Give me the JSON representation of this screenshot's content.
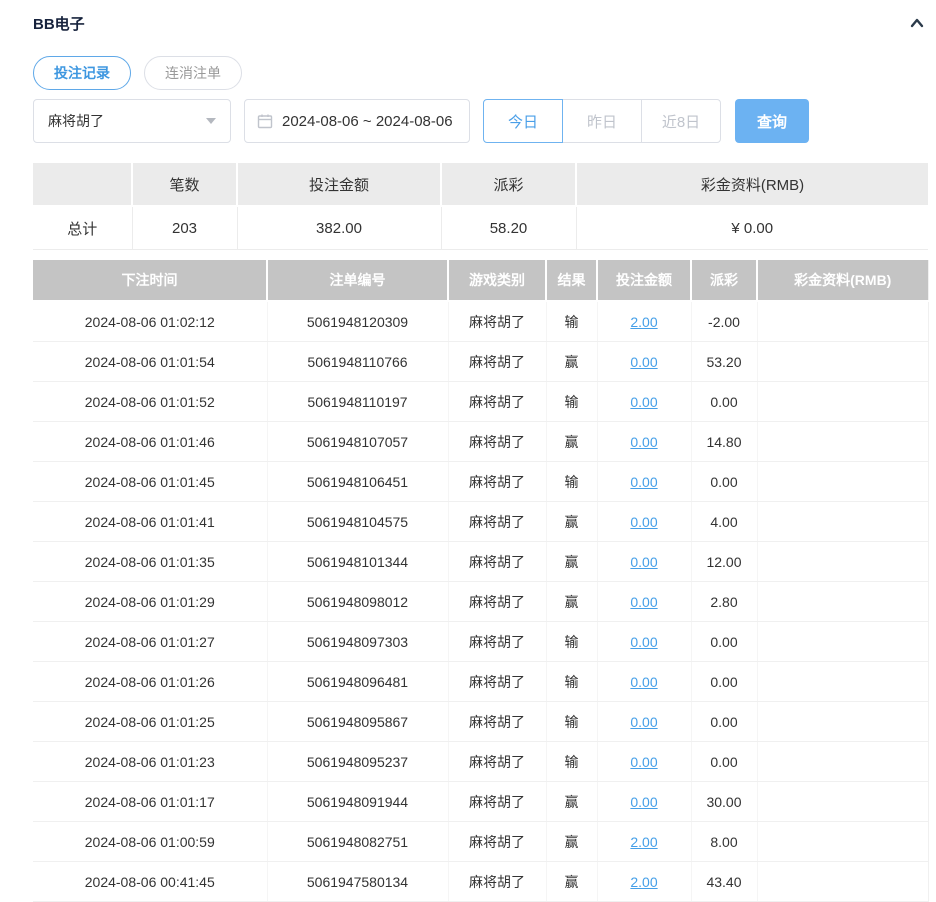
{
  "header": {
    "title": "BB电子"
  },
  "tabs": [
    {
      "label": "投注记录",
      "active": true
    },
    {
      "label": "连消注单",
      "active": false
    }
  ],
  "filters": {
    "game_select": {
      "value": "麻将胡了"
    },
    "date_range": "2024-08-06 ~ 2024-08-06",
    "quick_buttons": [
      {
        "label": "今日",
        "active": true
      },
      {
        "label": "昨日",
        "active": false
      },
      {
        "label": "近8日",
        "active": false
      }
    ],
    "search_label": "查询"
  },
  "summary": {
    "headers": [
      "",
      "笔数",
      "投注金额",
      "派彩",
      "彩金资料(RMB)"
    ],
    "row": {
      "label": "总计",
      "count": "203",
      "bet": "382.00",
      "payout": "58.20",
      "bonus": "¥ 0.00"
    }
  },
  "table": {
    "headers": [
      "下注时间",
      "注单编号",
      "游戏类别",
      "结果",
      "投注金额",
      "派彩",
      "彩金资料(RMB)"
    ],
    "rows": [
      {
        "time": "2024-08-06 01:02:12",
        "order": "5061948120309",
        "game": "麻将胡了",
        "result": "输",
        "bet": "2.00",
        "payout": "-2.00",
        "bonus": ""
      },
      {
        "time": "2024-08-06 01:01:54",
        "order": "5061948110766",
        "game": "麻将胡了",
        "result": "赢",
        "bet": "0.00",
        "payout": "53.20",
        "bonus": ""
      },
      {
        "time": "2024-08-06 01:01:52",
        "order": "5061948110197",
        "game": "麻将胡了",
        "result": "输",
        "bet": "0.00",
        "payout": "0.00",
        "bonus": ""
      },
      {
        "time": "2024-08-06 01:01:46",
        "order": "5061948107057",
        "game": "麻将胡了",
        "result": "赢",
        "bet": "0.00",
        "payout": "14.80",
        "bonus": ""
      },
      {
        "time": "2024-08-06 01:01:45",
        "order": "5061948106451",
        "game": "麻将胡了",
        "result": "输",
        "bet": "0.00",
        "payout": "0.00",
        "bonus": ""
      },
      {
        "time": "2024-08-06 01:01:41",
        "order": "5061948104575",
        "game": "麻将胡了",
        "result": "赢",
        "bet": "0.00",
        "payout": "4.00",
        "bonus": ""
      },
      {
        "time": "2024-08-06 01:01:35",
        "order": "5061948101344",
        "game": "麻将胡了",
        "result": "赢",
        "bet": "0.00",
        "payout": "12.00",
        "bonus": ""
      },
      {
        "time": "2024-08-06 01:01:29",
        "order": "5061948098012",
        "game": "麻将胡了",
        "result": "赢",
        "bet": "0.00",
        "payout": "2.80",
        "bonus": ""
      },
      {
        "time": "2024-08-06 01:01:27",
        "order": "5061948097303",
        "game": "麻将胡了",
        "result": "输",
        "bet": "0.00",
        "payout": "0.00",
        "bonus": ""
      },
      {
        "time": "2024-08-06 01:01:26",
        "order": "5061948096481",
        "game": "麻将胡了",
        "result": "输",
        "bet": "0.00",
        "payout": "0.00",
        "bonus": ""
      },
      {
        "time": "2024-08-06 01:01:25",
        "order": "5061948095867",
        "game": "麻将胡了",
        "result": "输",
        "bet": "0.00",
        "payout": "0.00",
        "bonus": ""
      },
      {
        "time": "2024-08-06 01:01:23",
        "order": "5061948095237",
        "game": "麻将胡了",
        "result": "输",
        "bet": "0.00",
        "payout": "0.00",
        "bonus": ""
      },
      {
        "time": "2024-08-06 01:01:17",
        "order": "5061948091944",
        "game": "麻将胡了",
        "result": "赢",
        "bet": "0.00",
        "payout": "30.00",
        "bonus": ""
      },
      {
        "time": "2024-08-06 01:00:59",
        "order": "5061948082751",
        "game": "麻将胡了",
        "result": "赢",
        "bet": "2.00",
        "payout": "8.00",
        "bonus": ""
      },
      {
        "time": "2024-08-06 00:41:45",
        "order": "5061947580134",
        "game": "麻将胡了",
        "result": "赢",
        "bet": "2.00",
        "payout": "43.40",
        "bonus": ""
      }
    ]
  },
  "colors": {
    "accent_blue": "#6cb2f2",
    "link_blue": "#449fe8",
    "negative_red": "#e65050",
    "table_header_gray": "#c4c4c4",
    "summary_header_gray": "#ebebeb"
  }
}
